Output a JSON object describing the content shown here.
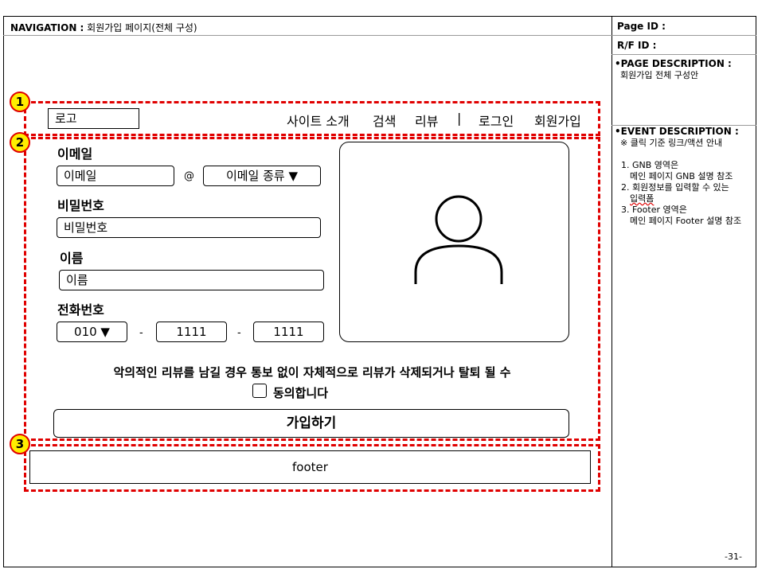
{
  "header": {
    "nav_label": "NAVIGATION :",
    "nav_value": "회원가입 페이지(전체 구성)",
    "page_id_label": "Page ID :",
    "rf_id_label": "R/F ID :"
  },
  "sidebar": {
    "page_desc_title": "•PAGE DESCRIPTION :",
    "page_desc_text": "회원가입 전체 구성안",
    "event_desc_title": "•EVENT DESCRIPTION :",
    "event_desc_sub": "※ 클릭 기준 링크/액션 안내",
    "events": [
      {
        "line1": "1. GNB 영역은",
        "line2": "메인 페이지 GNB 설명 참조"
      },
      {
        "line1": "2. 회원정보를 입력할 수 있는",
        "line2": "입력폼"
      },
      {
        "line1": "3. Footer 영역은",
        "line2": "메인 페이지 Footer 설명 참조"
      }
    ],
    "page_number": "-31-"
  },
  "badges": [
    "1",
    "2",
    "3"
  ],
  "gnb": {
    "logo": "로고",
    "items": [
      "사이트 소개",
      "검색",
      "리뷰",
      "|",
      "로그인",
      "회원가입"
    ]
  },
  "form": {
    "email_label": "이메일",
    "email_placeholder": "이메일",
    "at_sign": "@",
    "email_type": "이메일 종류 ▼",
    "password_label": "비밀번호",
    "password_placeholder": "비밀번호",
    "name_label": "이름",
    "name_placeholder": "이름",
    "phone_label": "전화번호",
    "phone_prefix": "010 ▼",
    "dash": "-",
    "phone_mid": "1111",
    "phone_last": "1111",
    "notice": "악의적인 리뷰를 남길 경우 통보 없이 자체적으로 리뷰가 삭제되거나 탈퇴 될 수",
    "agree_label": "동의합니다",
    "submit_label": "가입하기"
  },
  "footer": {
    "label": "footer"
  },
  "colors": {
    "dash_red": "#e00000",
    "badge_yellow": "#ffee00"
  }
}
